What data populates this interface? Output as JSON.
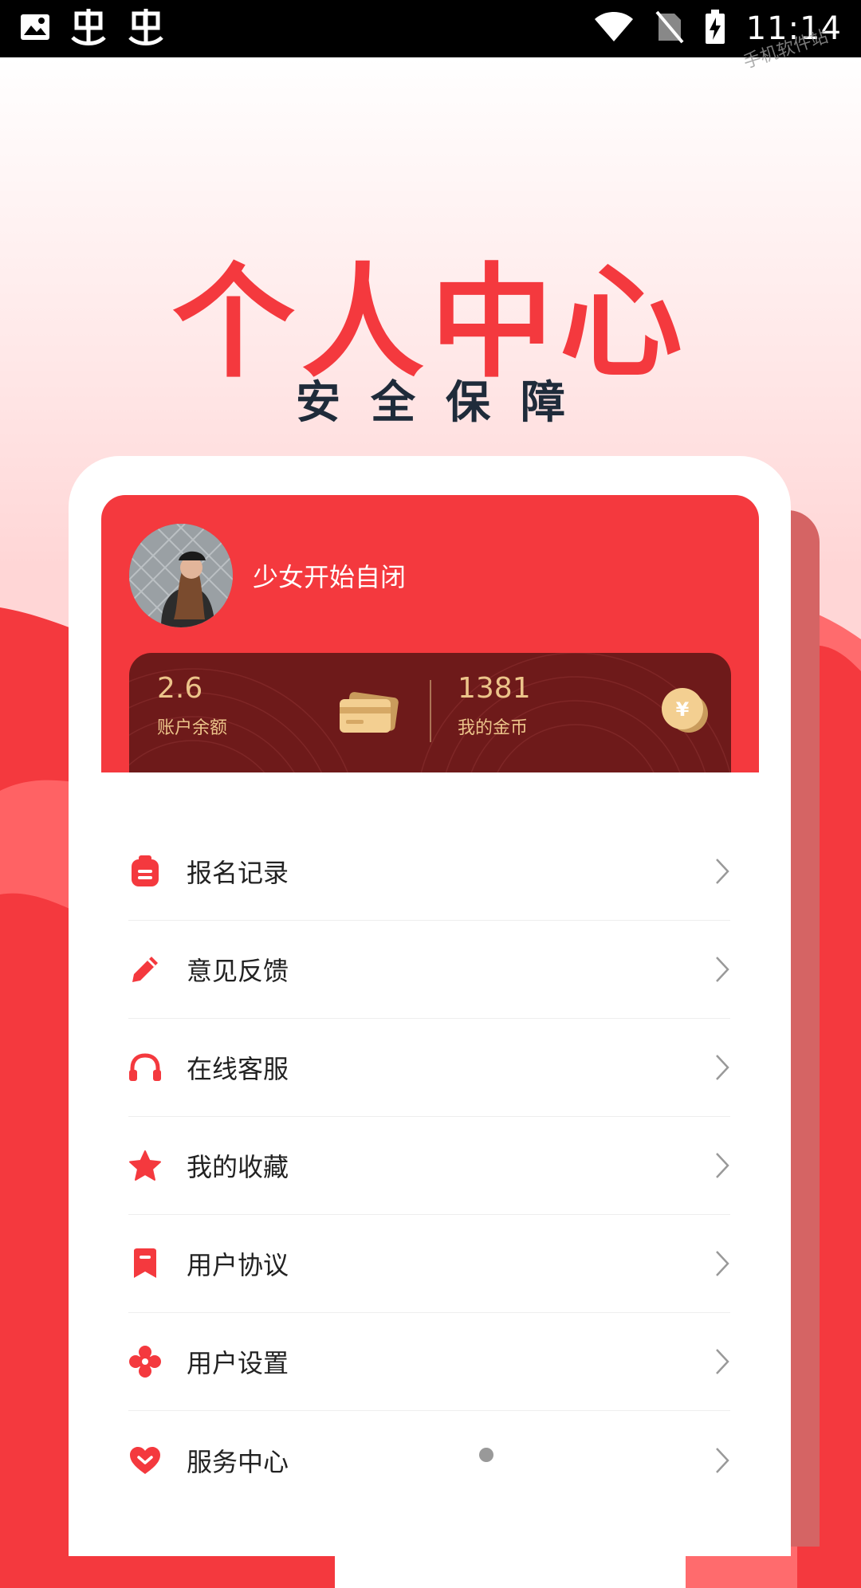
{
  "status_bar": {
    "time": "11:14",
    "left_icons": [
      "image-icon",
      "bug-icon",
      "bug-icon"
    ],
    "right_icons": [
      "wifi-icon",
      "no-sim-icon",
      "battery-charging-icon"
    ]
  },
  "watermark": "手机软件站",
  "hero": {
    "title": "个人中心",
    "subtitle": "安全保障"
  },
  "profile": {
    "username": "少女开始自闭",
    "balance": {
      "value": "2.6",
      "label": "账户余额",
      "icon": "card-icon"
    },
    "coins": {
      "value": "1381",
      "label": "我的金币",
      "icon": "coin-icon"
    }
  },
  "menu": [
    {
      "label": "报名记录",
      "icon": "clipboard-icon"
    },
    {
      "label": "意见反馈",
      "icon": "pencil-icon"
    },
    {
      "label": "在线客服",
      "icon": "headset-icon"
    },
    {
      "label": "我的收藏",
      "icon": "star-icon"
    },
    {
      "label": "用户协议",
      "icon": "bookmark-icon"
    },
    {
      "label": "用户设置",
      "icon": "settings-icon"
    },
    {
      "label": "服务中心",
      "icon": "heart-icon"
    }
  ],
  "colors": {
    "accent": "#f4393e",
    "wallet_bg": "#6e1a1a",
    "gold": "#ecc48a",
    "title_dark": "#1f2b3a"
  }
}
